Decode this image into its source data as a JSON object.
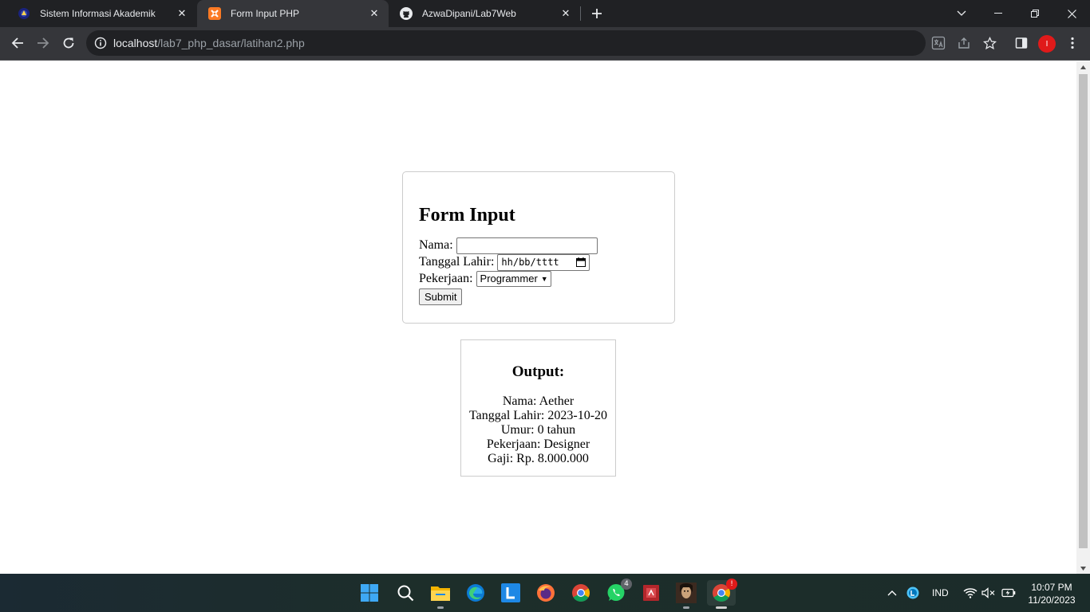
{
  "browser": {
    "tabs": [
      {
        "title": "Sistem Informasi Akademik",
        "icon": "university-logo-icon",
        "active": false
      },
      {
        "title": "Form Input PHP",
        "icon": "xampp-icon",
        "active": true
      },
      {
        "title": "AzwaDipani/Lab7Web",
        "icon": "github-icon",
        "active": false
      }
    ],
    "url": {
      "host": "localhost",
      "path": "/lab7_php_dasar/latihan2.php"
    },
    "profile_initial": "I",
    "profile_color": "#e01a1a"
  },
  "form": {
    "heading": "Form Input",
    "nama_label": "Nama:",
    "nama_value": "",
    "tanggal_label": "Tanggal Lahir:",
    "tanggal_placeholder": "hh/bb/tttt",
    "pekerjaan_label": "Pekerjaan:",
    "pekerjaan_selected": "Programmer",
    "submit_label": "Submit"
  },
  "output": {
    "heading": "Output:",
    "lines": [
      "Nama: Aether",
      "Tanggal Lahir: 2023-10-20",
      "Umur: 0 tahun",
      "Pekerjaan: Designer",
      "Gaji: Rp. 8.000.000"
    ]
  },
  "taskbar": {
    "apps": [
      "start-icon",
      "search-icon",
      "file-explorer-icon",
      "edge-icon",
      "launcher-l-icon",
      "firefox-icon",
      "chrome-icon",
      "whatsapp-icon",
      "pdf-reader-icon",
      "game-icon",
      "chrome-active-icon"
    ],
    "whatsapp_badge": "4",
    "chrome_badge": "!",
    "language": "IND",
    "time": "10:07 PM",
    "date": "11/20/2023"
  }
}
